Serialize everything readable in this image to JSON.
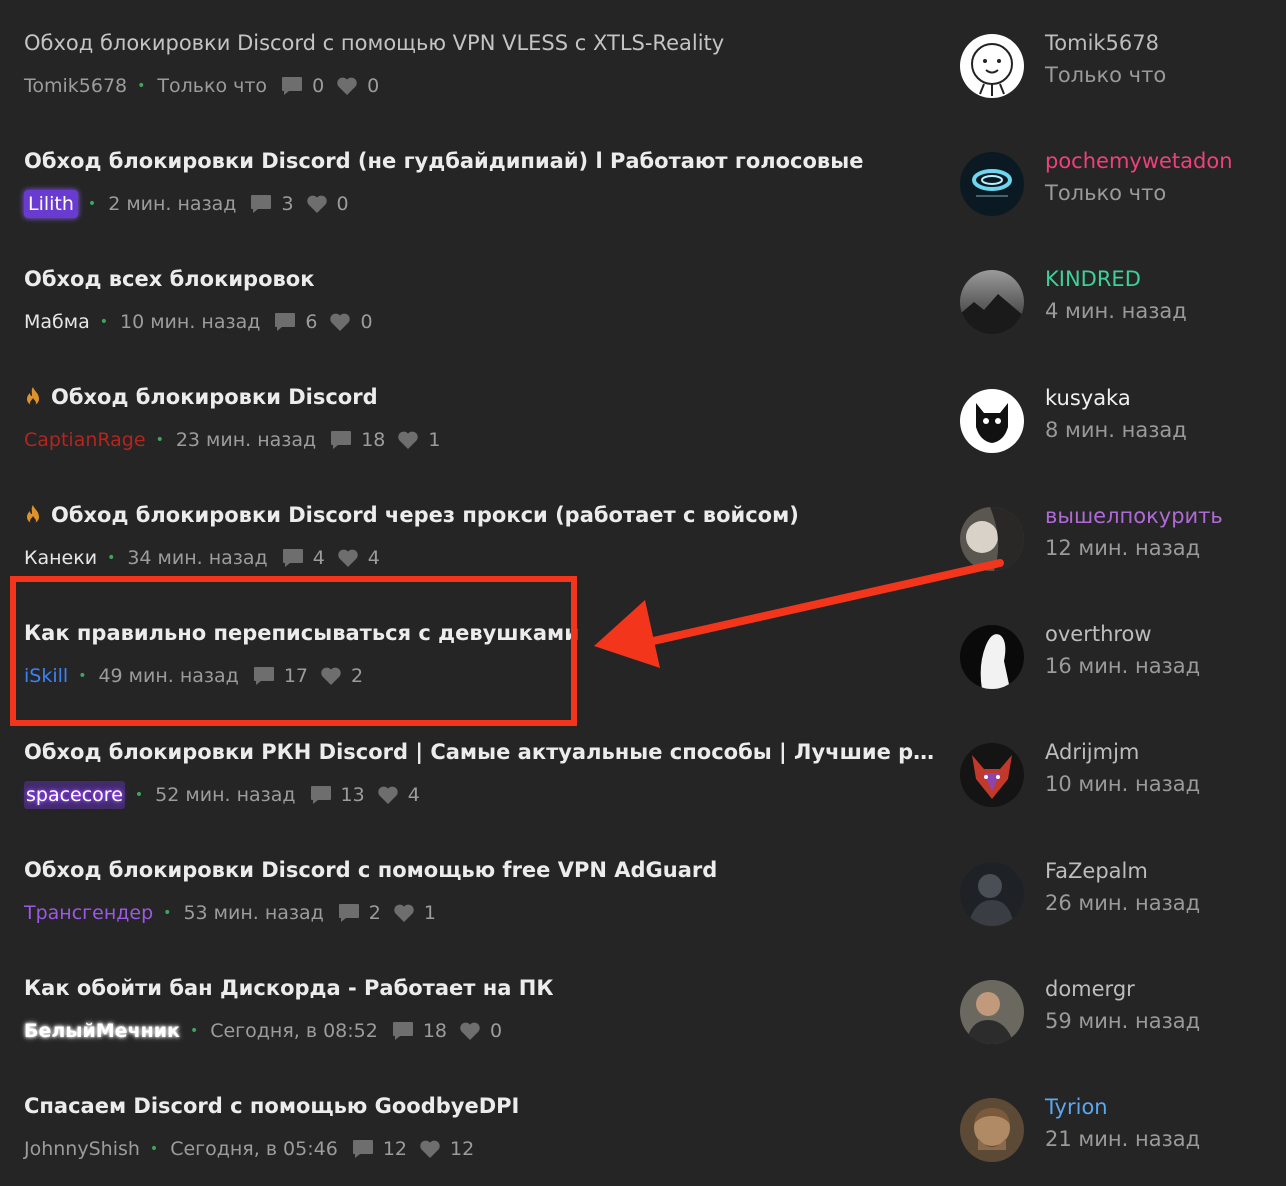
{
  "colors": {
    "background": "#252525",
    "title": "#ececec",
    "meta": "#9c9c9c",
    "separator_dot": "#3ea55f",
    "flame": "#e0922a",
    "highlight": "#f3361b"
  },
  "threads": [
    {
      "title": "Обход блокировки Discord с помощью VPN VLESS с XTLS-Reality",
      "author": "Tomik5678",
      "author_color": "#9c9c9c",
      "time": "Только что",
      "replies": "0",
      "likes": "0",
      "hot": false
    },
    {
      "title": "Обход блокировки Discord (не гудбайдипиай) l Работают голосовые",
      "author": "Lilith",
      "author_color": "#ffffff",
      "time": "2 мин. назад",
      "replies": "3",
      "likes": "0",
      "hot": false
    },
    {
      "title": "Обход всех блокировок",
      "author": "Мабма",
      "author_color": "#e6e6e6",
      "time": "10 мин. назад",
      "replies": "6",
      "likes": "0",
      "hot": false
    },
    {
      "title": "Обход блокировки Discord",
      "author": "CaptianRage",
      "author_color": "#b4251d",
      "time": "23 мин. назад",
      "replies": "18",
      "likes": "1",
      "hot": true
    },
    {
      "title": "Обход блокировки Discord через прокси (работает с войсом)",
      "author": "Канеки",
      "author_color": "#e6e6e6",
      "time": "34 мин. назад",
      "replies": "4",
      "likes": "4",
      "hot": true
    },
    {
      "title": "Как правильно переписываться с девушками",
      "author": "iSkill",
      "author_color": "#3b82f6",
      "time": "49 мин. назад",
      "replies": "17",
      "likes": "2",
      "hot": false
    },
    {
      "title": "Обход блокировки РКН Discord | Самые актуальные способы | Лучшие решения",
      "author": "spacecore",
      "author_color": "#ffffff",
      "time": "52 мин. назад",
      "replies": "13",
      "likes": "4",
      "hot": false
    },
    {
      "title": "Обход блокировки Discord с помощью free VPN AdGuard",
      "author": "Трансгендер",
      "author_color": "#9b59e6",
      "time": "53 мин. назад",
      "replies": "2",
      "likes": "1",
      "hot": false
    },
    {
      "title": "Как обойти бан Дискорда - Работает на ПК",
      "author": "БелыйМечник",
      "author_color": "#ffffff",
      "time": "Сегодня, в 08:52",
      "replies": "18",
      "likes": "0",
      "hot": false
    },
    {
      "title": "Спасаем Discord с помощью GoodbyeDPI",
      "author": "JohnnyShish",
      "author_color": "#9c9c9c",
      "time": "Сегодня, в 05:46",
      "replies": "12",
      "likes": "12",
      "hot": false
    }
  ],
  "recent_users": [
    {
      "name": "Tomik5678",
      "name_color": "#bdbdbd",
      "time": "Только что"
    },
    {
      "name": "pochemywetadon",
      "name_color": "#f0407a",
      "time": "Только что"
    },
    {
      "name": "KINDRED",
      "name_color": "#3ecf9a",
      "time": "4 мин. назад"
    },
    {
      "name": "kusyaka",
      "name_color": "#f0f0f0",
      "time": "8 мин. назад"
    },
    {
      "name": "вышелпокурить",
      "name_color": "#b06ad8",
      "time": "12 мин. назад"
    },
    {
      "name": "overthrow",
      "name_color": "#bdbdbd",
      "time": "16 мин. назад"
    },
    {
      "name": "Adrijmjm",
      "name_color": "#bdbdbd",
      "time": "10 мин. назад"
    },
    {
      "name": "FaZepalm",
      "name_color": "#bdbdbd",
      "time": "26 мин. назад"
    },
    {
      "name": "domergr",
      "name_color": "#bdbdbd",
      "time": "59 мин. назад"
    },
    {
      "name": "Tyrion",
      "name_color": "#5aa8f0",
      "time": "21 мин. назад"
    }
  ]
}
